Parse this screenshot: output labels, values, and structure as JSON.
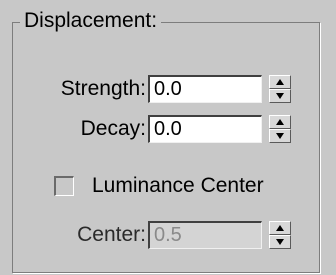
{
  "group": {
    "title": "Displacement:"
  },
  "strength": {
    "label": "Strength:",
    "value": "0.0"
  },
  "decay": {
    "label": "Decay:",
    "value": "0.0"
  },
  "luminance_center": {
    "label": "Luminance Center",
    "checked": false
  },
  "center": {
    "label": "Center:",
    "value": "0.5",
    "enabled": false
  }
}
